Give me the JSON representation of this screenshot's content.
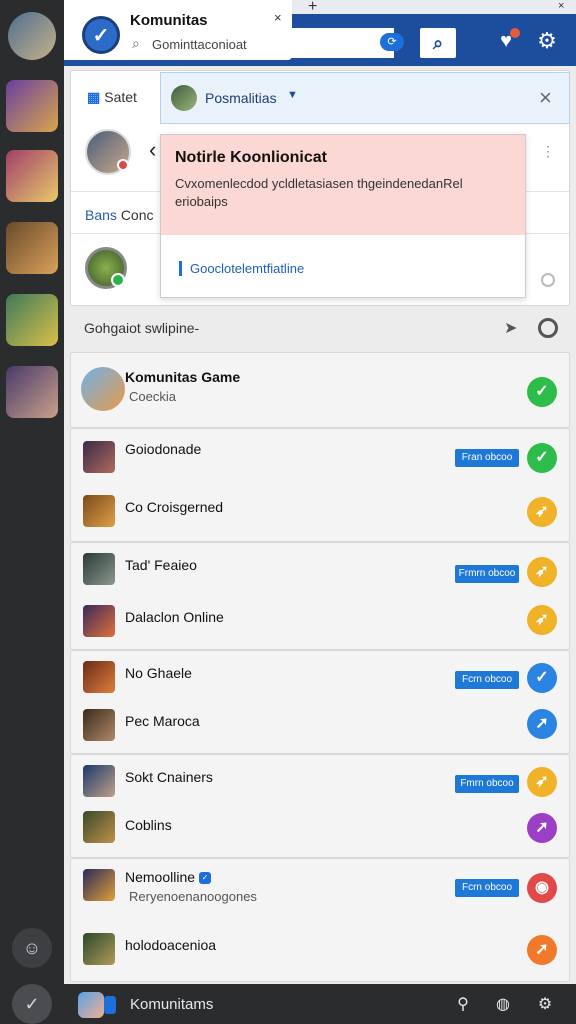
{
  "app": {
    "title": "Komunitas",
    "search_text": "Gominttaconioat",
    "toggle_label": "⟳",
    "tab_close": "×",
    "tab_add": "+",
    "window_close": "×"
  },
  "upper": {
    "select_label": "Satet",
    "bans_label_prefix": "Bans",
    "bans_label_rest": "Conc",
    "back": "‹"
  },
  "dropdown": {
    "label": "Posmalitias",
    "close": "×"
  },
  "notice": {
    "title": "Notirle Koonlionicat",
    "body": "Cvxomenlecdod ycldletasiasen thgeindenedanRel eriobaips",
    "link": "Gooclotelemtfiatline"
  },
  "section": {
    "title": "Gohgaiot swlipine-"
  },
  "list": [
    {
      "title": "Komunitas Game",
      "subtitle": "Coeckia",
      "badge": "",
      "status": "✓",
      "status_class": "s-green"
    },
    {
      "title": "Goiodonade",
      "subtitle": "",
      "badge": "Fran obcoo",
      "status": "✓",
      "status_class": "s-green"
    },
    {
      "title": "Co Croisgerned",
      "subtitle": "",
      "badge": "",
      "status": "➶",
      "status_class": "s-yellow"
    },
    {
      "title": "Tad' Feaieo",
      "subtitle": "",
      "badge": "Frmrn obcoo",
      "status": "➶",
      "status_class": "s-yellow"
    },
    {
      "title": "Dalaclon Online",
      "subtitle": "",
      "badge": "",
      "status": "➶",
      "status_class": "s-yellow"
    },
    {
      "title": "No Ghaele",
      "subtitle": "",
      "badge": "Fcrn obcoo",
      "status": "✓",
      "status_class": "s-blue"
    },
    {
      "title": "Pec Maroca",
      "subtitle": "",
      "badge": "",
      "status": "➚",
      "status_class": "s-blue"
    },
    {
      "title": "Sokt Cnainers",
      "subtitle": "",
      "badge": "Fmrn obcoo",
      "status": "➶",
      "status_class": "s-yellow"
    },
    {
      "title": "Coblins",
      "subtitle": "",
      "badge": "",
      "status": "➚",
      "status_class": "s-purple"
    },
    {
      "title": "Nemoolline",
      "subtitle": "Reryenoenanoogones",
      "badge": "Fcrn obcoo",
      "status": "◉",
      "status_class": "s-red"
    },
    {
      "title": "holodoacenioa",
      "subtitle": "",
      "badge": "",
      "status": "➚",
      "status_class": "s-orange"
    }
  ],
  "bottom": {
    "title": "Komunitams"
  }
}
